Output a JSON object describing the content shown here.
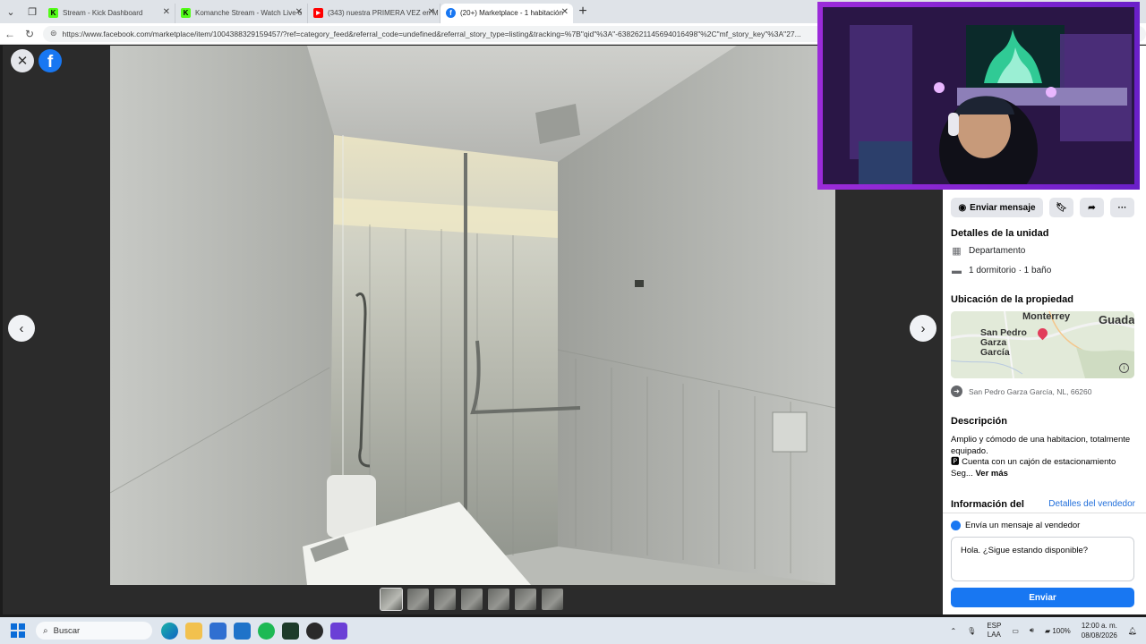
{
  "browser": {
    "tabs": [
      {
        "title": "Stream - Kick Dashboard",
        "favicon_color": "#53fc18",
        "favicon_char": "K",
        "active": false
      },
      {
        "title": "Komanche Stream - Watch Live o",
        "favicon_color": "#53fc18",
        "favicon_char": "K",
        "active": false
      },
      {
        "title": "(343) nuestra PRIMERA VEZ en M",
        "favicon_color": "#ff0000",
        "favicon_char": "▶",
        "active": false
      },
      {
        "title": "(20+) Marketplace - 1 habitación",
        "favicon_color": "#1877f2",
        "favicon_char": "f",
        "active": true
      }
    ],
    "url": "https://www.facebook.com/marketplace/item/1004388329159457/?ref=category_feed&referral_code=undefined&referral_story_type=listing&tracking=%7B\"qid\"%3A\"-6382621145694016498\"%2C\"mf_story_key\"%3A\"27..."
  },
  "listing": {
    "message_button": "Enviar mensaje",
    "unit_details_title": "Detalles de la unidad",
    "property_type": "Departamento",
    "rooms": "1 dormitorio · 1 baño",
    "location_title": "Ubicación de la propiedad",
    "map_labels": {
      "city1": "Monterrey",
      "city2": "Guada",
      "city3": "San Pedro Garza García"
    },
    "address": "San Pedro Garza García, NL, 66260",
    "description_title": "Descripción",
    "description_line1": "Amplio y cómodo de una habitacion, totalmente equipado.",
    "description_line2": "🅿 Cuenta con un cajón de estacionamiento",
    "description_line3": "Seg...",
    "see_more": "Ver más",
    "seller_info_title": "Información del",
    "seller_details_link": "Detalles del vendedor",
    "send_message_label": "Envía un mensaje al vendedor",
    "message_text": "Hola. ¿Sigue estando disponible?",
    "send_button": "Enviar"
  },
  "taskbar": {
    "search_placeholder": "Buscar",
    "lang_line1": "ESP",
    "lang_line2": "LAA",
    "battery": "100%",
    "time": "12:00 a. m.",
    "date": "08/08/2026"
  },
  "icons": [
    "close-icon",
    "facebook-logo-icon",
    "chevron-left-icon",
    "chevron-right-icon",
    "messenger-icon",
    "bookmark-icon",
    "share-icon",
    "more-icon",
    "building-icon",
    "bed-icon",
    "map-pin-icon",
    "info-icon",
    "directions-icon"
  ]
}
